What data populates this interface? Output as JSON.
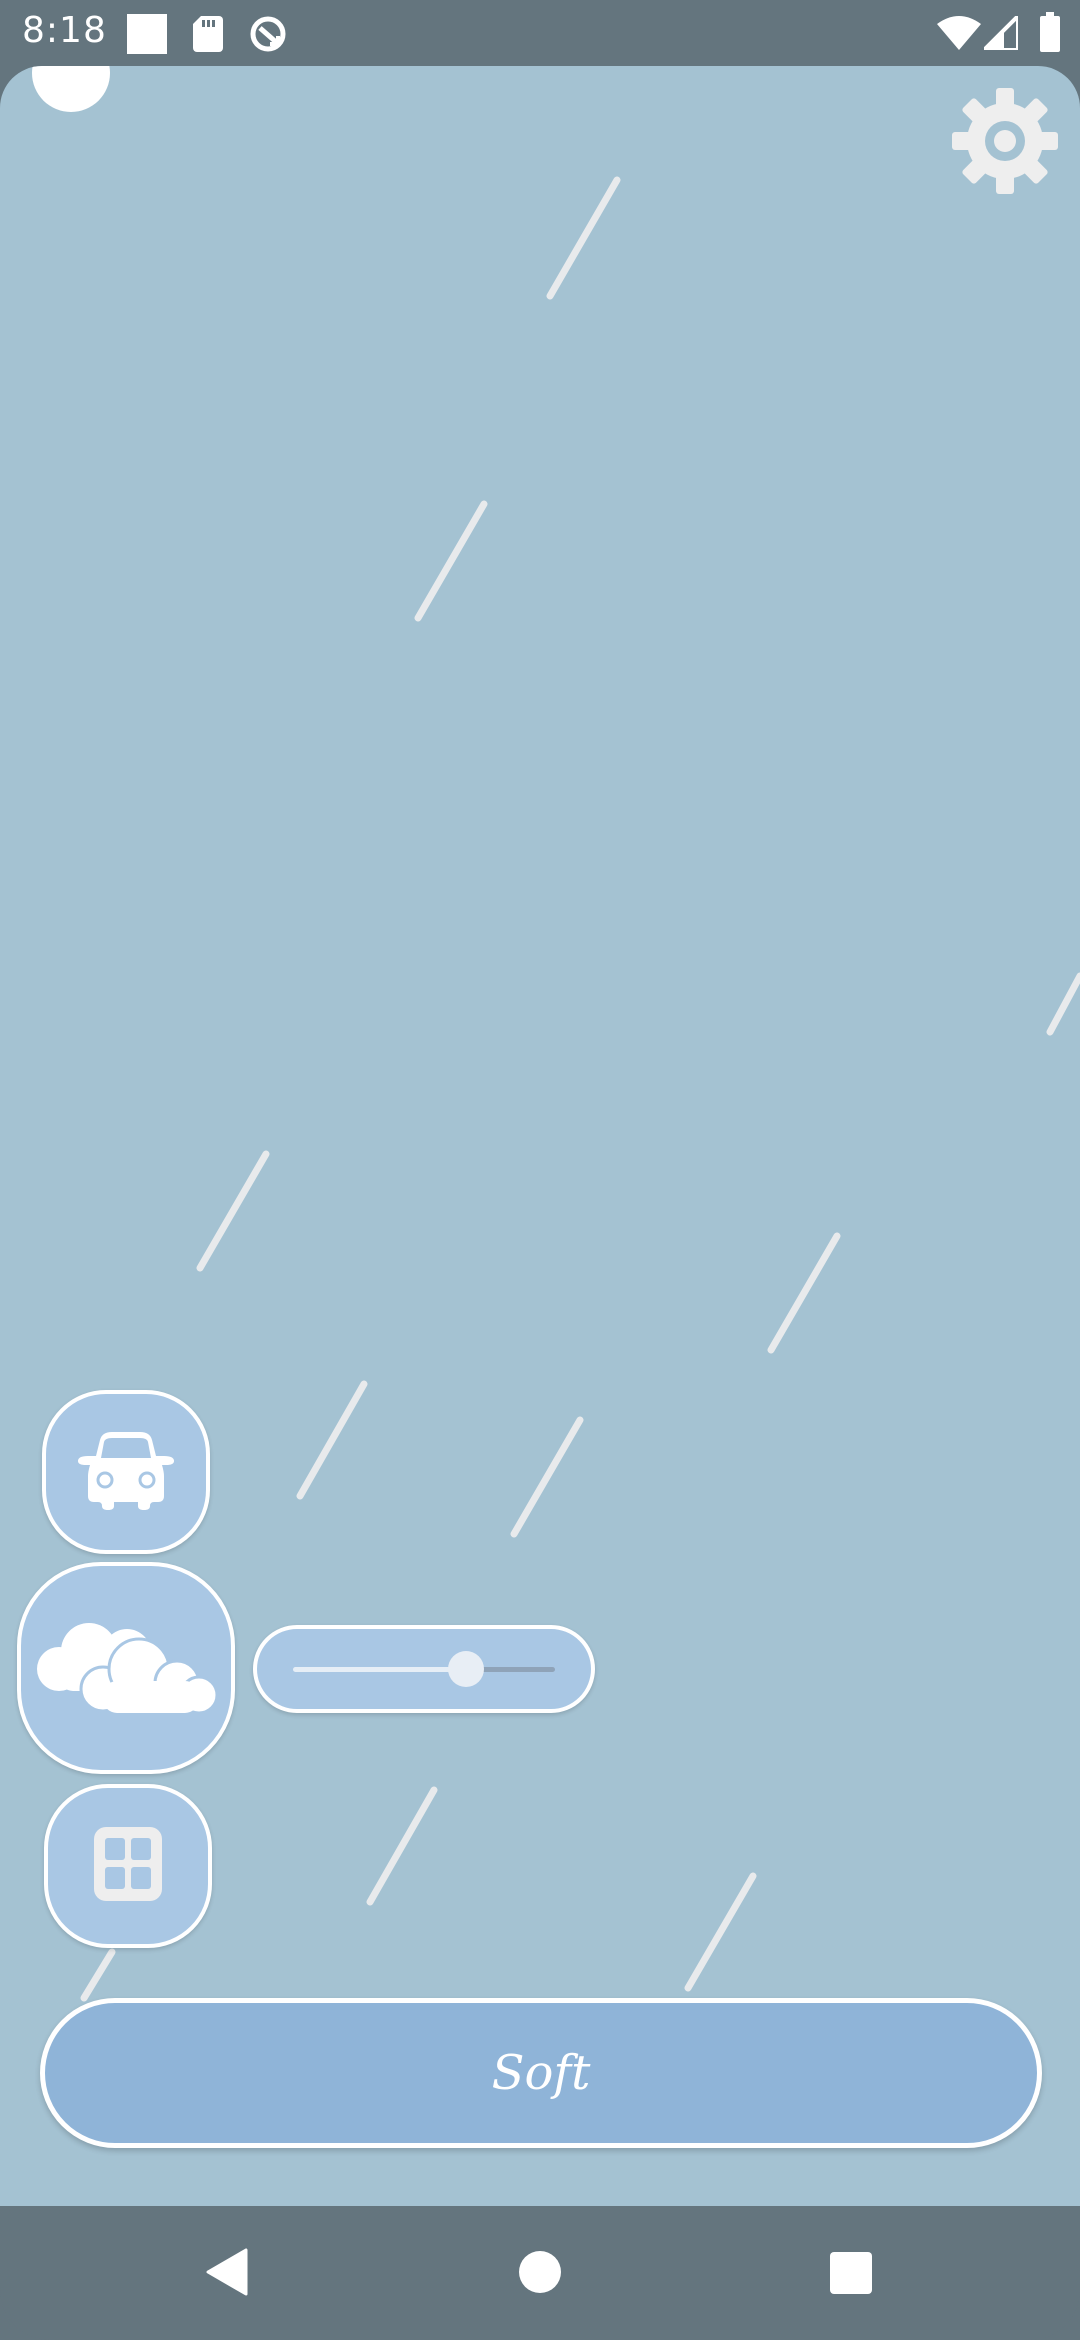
{
  "status_bar": {
    "time": "8:18",
    "left_icons": [
      "square-notification-icon",
      "sd-card-icon",
      "sync-icon"
    ],
    "right_icons": [
      "wifi-icon",
      "cell-signal-icon",
      "battery-icon"
    ]
  },
  "controls": {
    "mode_buttons": [
      {
        "icon": "car-icon"
      },
      {
        "icon": "cloud-icon",
        "selected": true
      },
      {
        "icon": "window-icon"
      }
    ],
    "intensity_slider_value": 0.66,
    "sound_type_label": "Soft"
  },
  "navigation": {
    "buttons": [
      "back-icon",
      "home-icon",
      "recents-icon"
    ]
  },
  "colors": {
    "background": "#a4c2d2",
    "button_fill": "#a9c7e4",
    "primary_button_fill": "#8fb4d8",
    "system_bars": "#64757e"
  }
}
